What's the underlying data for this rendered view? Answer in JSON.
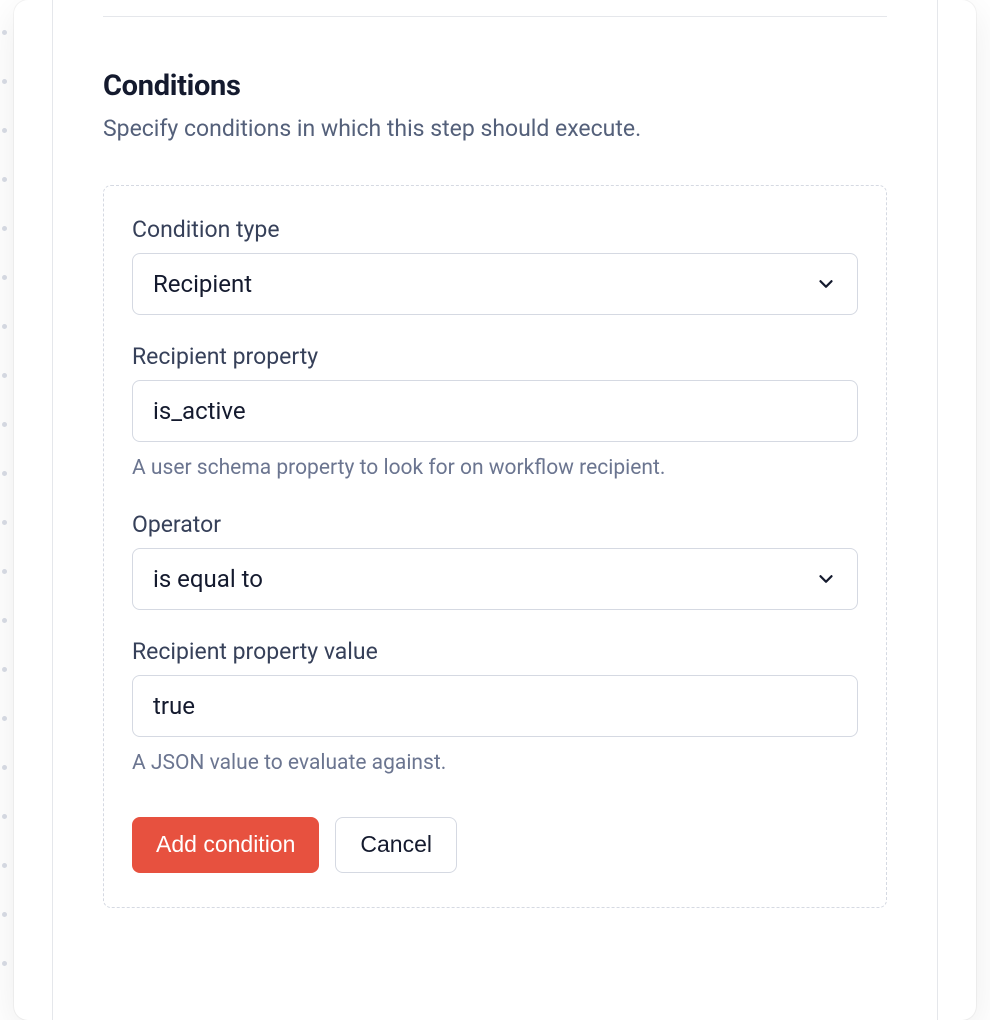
{
  "section": {
    "title": "Conditions",
    "subtitle": "Specify conditions in which this step should execute."
  },
  "fields": {
    "condition_type": {
      "label": "Condition type",
      "value": "Recipient"
    },
    "recipient_property": {
      "label": "Recipient property",
      "value": "is_active",
      "help": "A user schema property to look for on workflow recipient."
    },
    "operator": {
      "label": "Operator",
      "value": "is equal to"
    },
    "recipient_property_value": {
      "label": "Recipient property value",
      "value": "true",
      "help": "A JSON value to evaluate against."
    }
  },
  "buttons": {
    "add": "Add condition",
    "cancel": "Cancel"
  }
}
